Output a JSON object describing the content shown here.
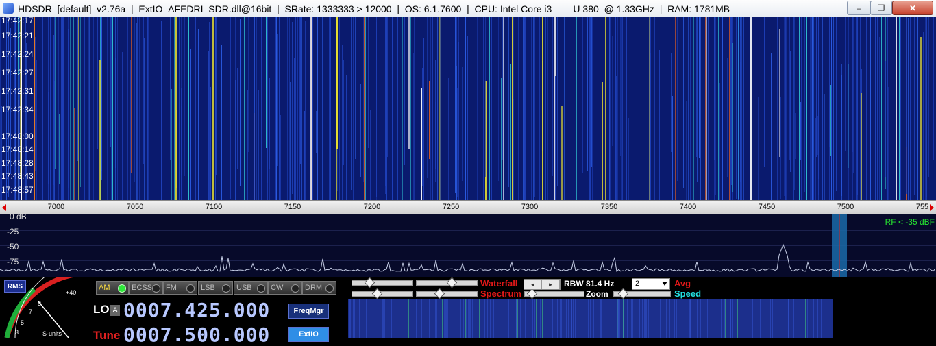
{
  "window": {
    "title": "HDSDR  [default]  v2.76a  |  ExtIO_AFEDRI_SDR.dll@16bit  |  SRate: 1333333 > 12000  |  OS: 6.1.7600  |  CPU: Intel Core i3        U 380  @ 1.33GHz  |  RAM: 1781MB",
    "minimize": "–",
    "maximize": "❐",
    "close": "✕"
  },
  "waterfall": {
    "time_labels": [
      "17:42:17",
      "17:42:21",
      "17:42:24",
      "17:42:27",
      "17:42:31",
      "17:42:34",
      "17:48:00",
      "17:48:14",
      "17:48:28",
      "17:48:43",
      "17:48:57"
    ]
  },
  "frequency_axis": {
    "ticks": [
      "7000",
      "7050",
      "7100",
      "7150",
      "7200",
      "7250",
      "7300",
      "7350",
      "7400",
      "7450",
      "7500",
      "755"
    ]
  },
  "spectrum": {
    "db_labels": [
      "0 dB",
      "-25",
      "-50",
      "-75"
    ],
    "rf_label": "RF < -35 dBF"
  },
  "controls": {
    "rms": "RMS",
    "smeter": {
      "plus40": "+40",
      "nine": "9",
      "seven": "7",
      "five": "5",
      "three": "3",
      "units": "S-units"
    },
    "modes": [
      {
        "label": "AM",
        "active": true
      },
      {
        "label": "ECSS",
        "active": false
      },
      {
        "label": "FM",
        "active": false
      },
      {
        "label": "LSB",
        "active": false
      },
      {
        "label": "USB",
        "active": false
      },
      {
        "label": "CW",
        "active": false
      },
      {
        "label": "DRM",
        "active": false
      }
    ],
    "lo_label": "LO",
    "lo_a": "A",
    "lo_freq": "0007.425.000",
    "tune_label": "Tune",
    "tune_freq": "0007.500.000",
    "freqmgr": "FreqMgr",
    "extio": "ExtIO",
    "waterfall_label": "Waterfall",
    "spectrum_label": "Spectrum",
    "rbw_label": "RBW 81.4 Hz",
    "avg_select": "2",
    "avg_label": "Avg",
    "zoom_label": "Zoom",
    "speed_label": "Speed",
    "spin_left": "◄",
    "spin_right": "►"
  }
}
